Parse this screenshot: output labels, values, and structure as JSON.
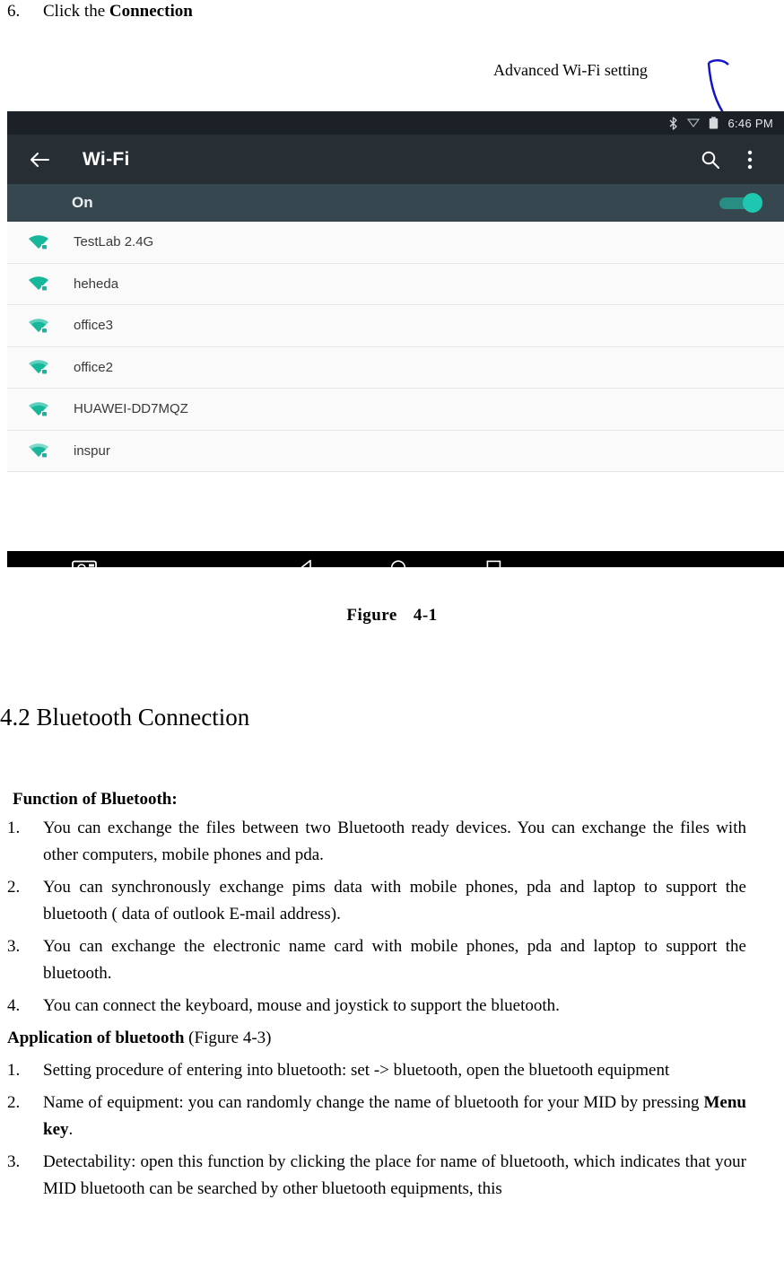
{
  "step6": {
    "number": "6.",
    "text_before": "Click the ",
    "text_bold": "Connection"
  },
  "callout": {
    "label": "Advanced Wi-Fi setting"
  },
  "screenshot": {
    "status_bar": {
      "bluetooth_icon": "bluetooth-icon",
      "cast_icon": "cast-icon",
      "battery_icon": "battery-icon",
      "time": "6:46 PM"
    },
    "action_bar": {
      "back_icon": "back-arrow-icon",
      "title": "Wi-Fi",
      "search_icon": "search-icon",
      "overflow_icon": "overflow-menu-icon"
    },
    "toggle_row": {
      "label": "On",
      "switch_state": "on",
      "accent_color": "#1ec8b0"
    },
    "networks": [
      {
        "ssid": "TestLab 2.4G",
        "secured": true,
        "signal": 4
      },
      {
        "ssid": "heheda",
        "secured": true,
        "signal": 4
      },
      {
        "ssid": "office3",
        "secured": true,
        "signal": 3
      },
      {
        "ssid": "office2",
        "secured": true,
        "signal": 3
      },
      {
        "ssid": "HUAWEI-DD7MQZ",
        "secured": true,
        "signal": 3
      },
      {
        "ssid": "inspur",
        "secured": true,
        "signal": 3
      }
    ],
    "nav_bar": {
      "screenshot_icon": "screenshot-camera-icon",
      "back_icon": "nav-back-triangle-icon",
      "home_icon": "nav-home-circle-icon",
      "recents_icon": "nav-recents-square-icon"
    }
  },
  "figure": {
    "label": "Figure",
    "number": "4-1"
  },
  "heading": {
    "text": "4.2 Bluetooth Connection"
  },
  "function_section": {
    "lead": "Function of Bluetooth:",
    "items": [
      {
        "number": "1.",
        "text": "You can exchange the files between two Bluetooth ready devices. You can exchange the files with other computers, mobile phones and pda."
      },
      {
        "number": "2.",
        "text": "You can synchronously exchange pims data with mobile phones, pda and laptop to support the bluetooth ( data of outlook E-mail address)."
      },
      {
        "number": "3.",
        "text": "You can exchange the electronic name card with mobile phones, pda and laptop to support the bluetooth."
      },
      {
        "number": "4.",
        "text": "You can connect the keyboard, mouse and joystick to support the bluetooth."
      }
    ]
  },
  "application_section": {
    "lead_bold": "Application of bluetooth",
    "lead_rest": " (Figure 4-3)",
    "items": [
      {
        "number": "1.",
        "text": "Setting procedure of entering into bluetooth: set -> bluetooth, open the bluetooth equipment"
      },
      {
        "number": "2.",
        "text_before": "Name of equipment: you can randomly change the name of bluetooth for your MID by pressing ",
        "text_bold": "Menu key",
        "text_after": "."
      },
      {
        "number": "3.",
        "text": "Detectability: open this function by clicking the place for name of bluetooth, which indicates that your MID bluetooth can be searched by other bluetooth equipments, this"
      }
    ]
  }
}
